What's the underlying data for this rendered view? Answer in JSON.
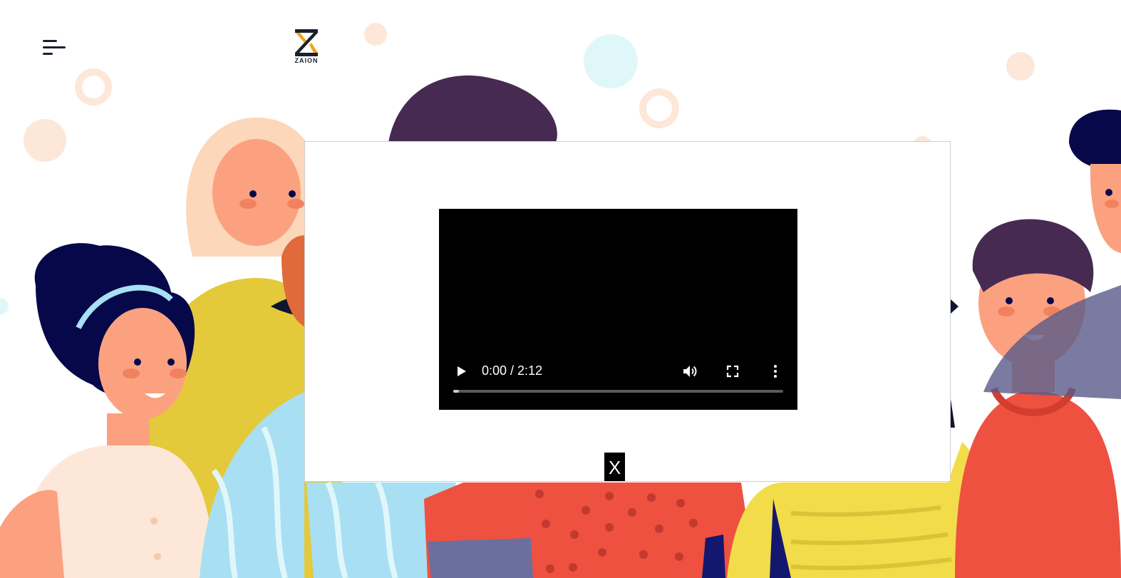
{
  "header": {
    "logo_text": "ZAION",
    "menu_icon": "hamburger-menu-icon"
  },
  "video_player": {
    "time_display": "0:00 / 2:12",
    "current_time": "0:00",
    "duration": "2:12",
    "progress_fraction": 0.0,
    "icons": [
      "play-icon",
      "volume-icon",
      "fullscreen-icon",
      "more-options-icon"
    ]
  },
  "modal": {
    "close_label": "X"
  },
  "colors": {
    "logo_dark": "#1b2030",
    "logo_accent": "#f2a31b",
    "modal_bg": "#ffffff",
    "video_bg": "#000000",
    "bg_red": "#ee5140",
    "bg_yellow": "#f2dc4a",
    "bg_navy": "#06084a",
    "bg_skin": "#fba17f"
  }
}
